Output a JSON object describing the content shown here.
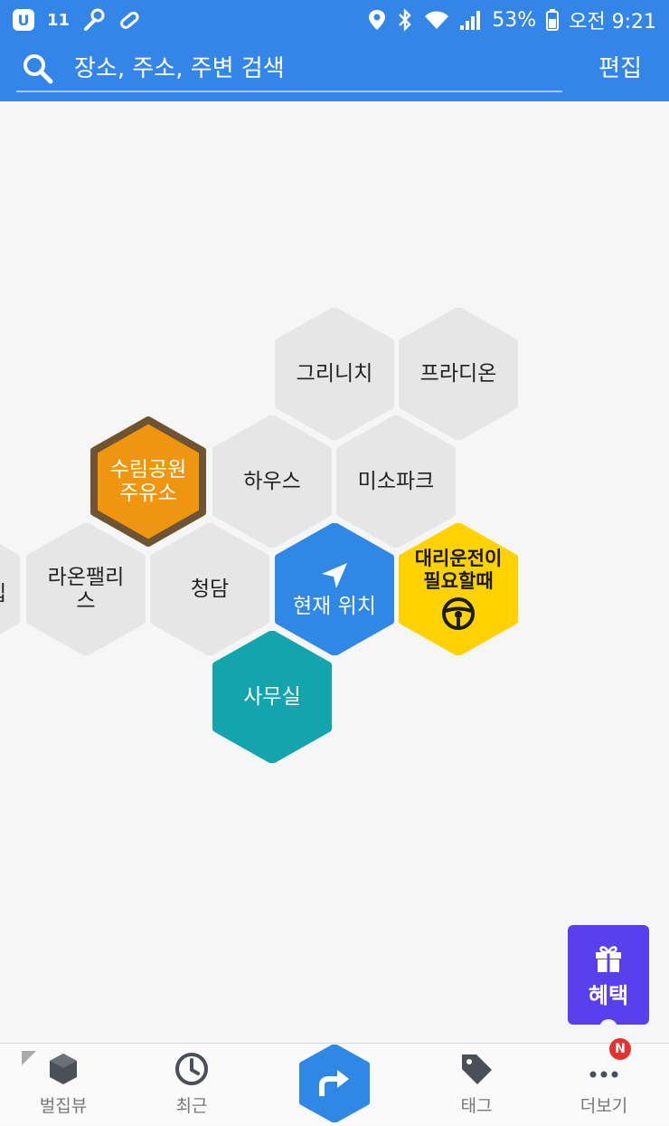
{
  "status_bar": {
    "carrier_badge": "11",
    "battery": "53%",
    "time": "오전 9:21"
  },
  "search": {
    "placeholder": "장소, 주소, 주변 검색",
    "edit_label": "편집"
  },
  "places": {
    "greenwich": "그리니치",
    "pradion": "프라디온",
    "gas_station": "수림공원 주유소",
    "house": "하우스",
    "misopark": "미소파크",
    "partial_left": "입",
    "laon_palace": "라온팰리스",
    "cheongdam": "청담",
    "current_location": "현재 위치",
    "designated_driver": "대리운전이 필요할때",
    "office": "사무실"
  },
  "benefit_button": {
    "label": "혜택"
  },
  "bottom_nav": {
    "view": "벌집뷰",
    "recent": "최근",
    "tag": "태그",
    "more": "더보기",
    "more_badge": "N"
  },
  "colors": {
    "primary": "#3485e8",
    "hex_gray": "#e6e6e6",
    "gas_fill": "#ef9510",
    "gas_border": "#6e5433",
    "current_blue": "#2f88e6",
    "driver_yellow": "#ffd200",
    "office_teal": "#14a4ae",
    "benefit_purple": "#5a3fee"
  }
}
